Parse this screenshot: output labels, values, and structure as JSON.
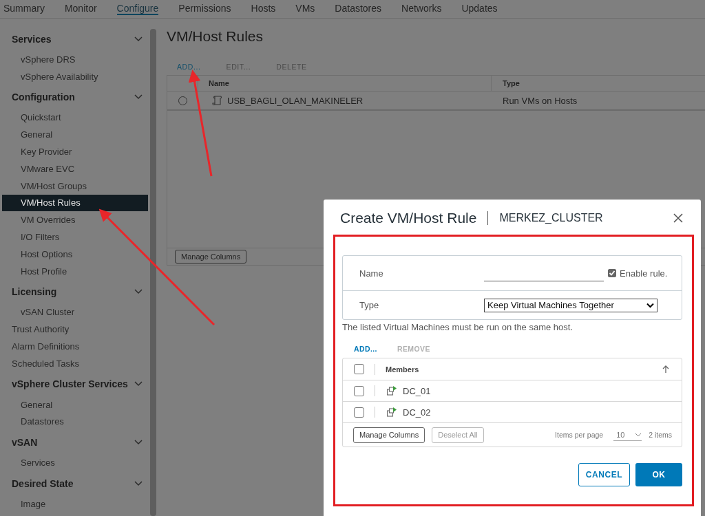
{
  "tabs": [
    {
      "label": "Summary",
      "selected": false
    },
    {
      "label": "Monitor",
      "selected": false
    },
    {
      "label": "Configure",
      "selected": true
    },
    {
      "label": "Permissions",
      "selected": false
    },
    {
      "label": "Hosts",
      "selected": false
    },
    {
      "label": "VMs",
      "selected": false
    },
    {
      "label": "Datastores",
      "selected": false
    },
    {
      "label": "Networks",
      "selected": false
    },
    {
      "label": "Updates",
      "selected": false
    }
  ],
  "sidebar": {
    "items": [
      {
        "kind": "group",
        "label": "Services",
        "expanded": true,
        "children": [
          {
            "label": "vSphere DRS",
            "selected": false
          },
          {
            "label": "vSphere Availability",
            "selected": false
          }
        ]
      },
      {
        "kind": "group",
        "label": "Configuration",
        "expanded": true,
        "children": [
          {
            "label": "Quickstart",
            "selected": false
          },
          {
            "label": "General",
            "selected": false
          },
          {
            "label": "Key Provider",
            "selected": false
          },
          {
            "label": "VMware EVC",
            "selected": false
          },
          {
            "label": "VM/Host Groups",
            "selected": false
          },
          {
            "label": "VM/Host Rules",
            "selected": true
          },
          {
            "label": "VM Overrides",
            "selected": false
          },
          {
            "label": "I/O Filters",
            "selected": false
          },
          {
            "label": "Host Options",
            "selected": false
          },
          {
            "label": "Host Profile",
            "selected": false
          }
        ]
      },
      {
        "kind": "group",
        "label": "Licensing",
        "expanded": true,
        "children": [
          {
            "label": "vSAN Cluster",
            "selected": false
          }
        ]
      },
      {
        "kind": "link",
        "label": "Trust Authority",
        "selected": false
      },
      {
        "kind": "link",
        "label": "Alarm Definitions",
        "selected": false
      },
      {
        "kind": "link",
        "label": "Scheduled Tasks",
        "selected": false
      },
      {
        "kind": "group",
        "label": "vSphere Cluster Services",
        "expanded": true,
        "children": [
          {
            "label": "General",
            "selected": false
          },
          {
            "label": "Datastores",
            "selected": false
          }
        ]
      },
      {
        "kind": "group",
        "label": "vSAN",
        "expanded": true,
        "children": [
          {
            "label": "Services",
            "selected": false
          }
        ]
      },
      {
        "kind": "group",
        "label": "Desired State",
        "expanded": true,
        "children": [
          {
            "label": "Image",
            "selected": false
          }
        ]
      }
    ]
  },
  "main": {
    "title": "VM/Host Rules",
    "toolbar": [
      {
        "label": "ADD...",
        "disabled": false
      },
      {
        "label": "EDIT...",
        "disabled": true
      },
      {
        "label": "DELETE",
        "disabled": true
      }
    ],
    "table": {
      "columns": [
        "Name",
        "Type"
      ],
      "rows": [
        {
          "selected": false,
          "name": "USB_BAGLI_OLAN_MAKINELER",
          "type": "Run VMs on Hosts"
        }
      ],
      "footer_button": "Manage Columns"
    }
  },
  "dialog": {
    "title": "Create VM/Host Rule",
    "subtitle": "MERKEZ_CLUSTER",
    "name_label": "Name",
    "enable": {
      "label": "Enable rule.",
      "checked": true
    },
    "type_label": "Type",
    "type_value": "Keep Virtual Machines Together",
    "description": "The listed Virtual Machines must be run on the same host.",
    "toolbar": [
      {
        "label": "ADD...",
        "disabled": false
      },
      {
        "label": "REMOVE",
        "disabled": true
      }
    ],
    "grid": {
      "select_all": false,
      "column": "Members",
      "rows": [
        {
          "name": "DC_01",
          "checked": false
        },
        {
          "name": "DC_02",
          "checked": false
        }
      ],
      "footer_buttons": [
        {
          "label": "Manage Columns",
          "disabled": false
        },
        {
          "label": "Deselect All",
          "disabled": true
        }
      ],
      "items_per_page_label": "Items per page",
      "items_per_page": "10",
      "count": "2 items"
    },
    "buttons": [
      {
        "label": "CANCEL",
        "kind": "secondary"
      },
      {
        "label": "OK",
        "kind": "primary"
      }
    ]
  }
}
